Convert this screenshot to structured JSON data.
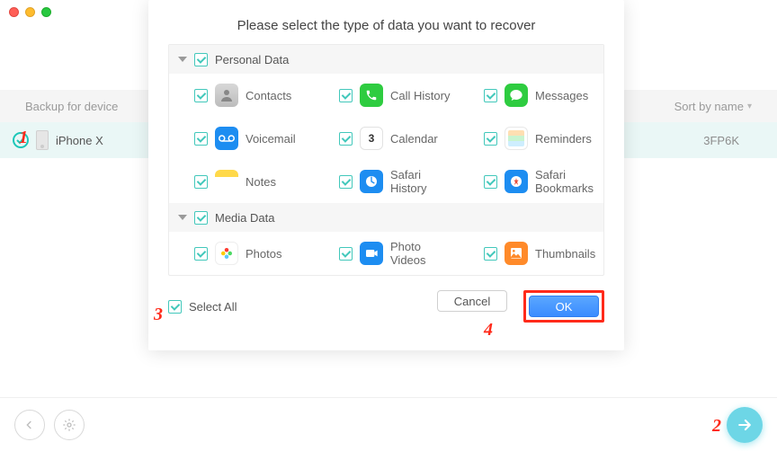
{
  "traffic": {
    "close": "close",
    "min": "minimize",
    "max": "zoom"
  },
  "deviceHeader": {
    "label": "Backup for device",
    "sort": "Sort by name",
    "sortCaret": "▾"
  },
  "deviceRow": {
    "name": "iPhone X",
    "udid": "3FP6K"
  },
  "modal": {
    "title": "Please select the type of data you want to recover",
    "groups": {
      "personal": {
        "label": "Personal Data",
        "items": [
          {
            "label": "Contacts"
          },
          {
            "label": "Call History"
          },
          {
            "label": "Messages"
          },
          {
            "label": "Voicemail"
          },
          {
            "label": "Calendar",
            "calDay": "3"
          },
          {
            "label": "Reminders"
          },
          {
            "label": "Notes"
          },
          {
            "label": "Safari History"
          },
          {
            "label": "Safari Bookmarks"
          }
        ]
      },
      "media": {
        "label": "Media Data",
        "items": [
          {
            "label": "Photos"
          },
          {
            "label": "Photo Videos"
          },
          {
            "label": "Thumbnails"
          }
        ]
      }
    },
    "selectAll": "Select All",
    "cancel": "Cancel",
    "ok": "OK"
  },
  "annotations": {
    "n1": "1",
    "n2": "2",
    "n3": "3",
    "n4": "4"
  }
}
